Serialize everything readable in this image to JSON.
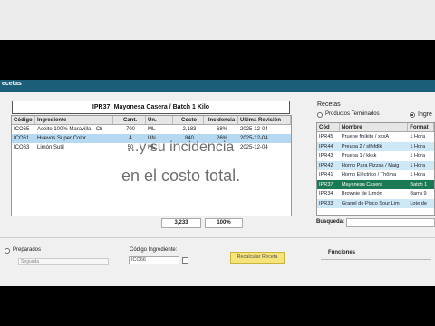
{
  "window": {
    "title": "ecetas"
  },
  "recipe": {
    "header": "IPR37:    Mayonesa Casera / Batch 1 Kilo"
  },
  "ingredients": {
    "columns": [
      "Código",
      "Ingrediente",
      "Cant.",
      "Un.",
      "Costo",
      "Incidencia",
      "Ultima Revisión"
    ],
    "rows": [
      {
        "code": "ICO65",
        "name": "Aceite 100% Maravilla - Ch",
        "qty": "700",
        "unit": "ML",
        "cost": "2,183",
        "incidence": "68%",
        "revision": "2025-12-04"
      },
      {
        "code": "ICO61",
        "name": "Huevos Super Color",
        "qty": "4",
        "unit": "UN",
        "cost": "840",
        "incidence": "26%",
        "revision": "2025-12-04"
      },
      {
        "code": "ICO63",
        "name": "Limón Sutil",
        "qty": "50",
        "unit": "ML",
        "cost": "",
        "incidence": "",
        "revision": "2025-12-04"
      }
    ],
    "total_cost": "3,233",
    "total_incidence": "100%"
  },
  "caption": {
    "line1": "...y su incidencia",
    "line2": "en el costo total."
  },
  "recipes_panel": {
    "label": "Recetas",
    "radio_terminados": "Productos Terminados",
    "radio_other": "Ingre",
    "columns": [
      "Cód",
      "Nombre",
      "Format"
    ],
    "rows": [
      {
        "code": "IPR45",
        "name": "Pruebe finikito / xxxA",
        "format": "1 Hora"
      },
      {
        "code": "IPR44",
        "name": "Preuba 2 / slfsfdlk",
        "format": "1 Hora"
      },
      {
        "code": "IPR43",
        "name": "Prueba 1 / kkkk",
        "format": "1 Hora"
      },
      {
        "code": "IPR42",
        "name": "Horno Para Pizzas / Maig",
        "format": "1 Hora"
      },
      {
        "code": "IPR41",
        "name": "Horno Eléctrico / Thôma",
        "format": "1 Hora"
      },
      {
        "code": "IPR37",
        "name": "Mayonesa Casera",
        "format": "Batch 1"
      },
      {
        "code": "IPR34",
        "name": "Brownie de Limón",
        "format": "Barra 9"
      },
      {
        "code": "IPR33",
        "name": "Granel de Pisco Sour Lim",
        "format": "Lote de"
      }
    ],
    "search_label": "Busqueda:"
  },
  "bottom": {
    "preparados_label": "Preparados",
    "preparados_field": "Seguada",
    "codigo_label": "Código Ingrediente:",
    "codigo_value": "ICO66",
    "recalc_button": "Recalcular Receta",
    "funciones_label": "Funciones"
  }
}
